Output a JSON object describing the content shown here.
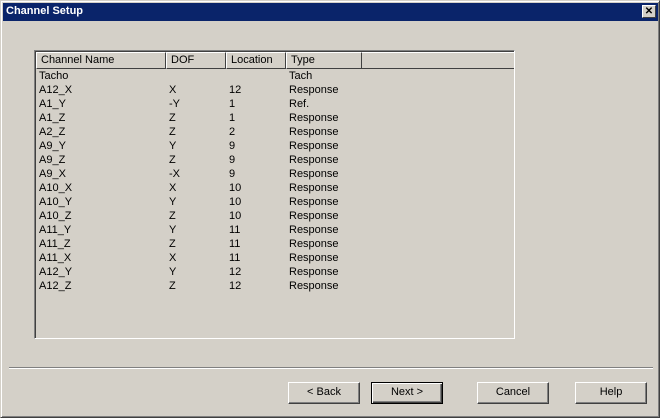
{
  "window": {
    "title": "Channel Setup",
    "close_glyph": "✕"
  },
  "table": {
    "headers": [
      "Channel Name",
      "DOF",
      "Location",
      "Type"
    ],
    "rows": [
      [
        "Tacho",
        "",
        "",
        "Tach"
      ],
      [
        "A12_X",
        "X",
        "12",
        "Response"
      ],
      [
        "A1_Y",
        "-Y",
        "1",
        "Ref."
      ],
      [
        "A1_Z",
        "Z",
        "1",
        "Response"
      ],
      [
        "A2_Z",
        "Z",
        "2",
        "Response"
      ],
      [
        "A9_Y",
        "Y",
        "9",
        "Response"
      ],
      [
        "A9_Z",
        "Z",
        "9",
        "Response"
      ],
      [
        "A9_X",
        "-X",
        "9",
        "Response"
      ],
      [
        "A10_X",
        "X",
        "10",
        "Response"
      ],
      [
        "A10_Y",
        "Y",
        "10",
        "Response"
      ],
      [
        "A10_Z",
        "Z",
        "10",
        "Response"
      ],
      [
        "A11_Y",
        "Y",
        "11",
        "Response"
      ],
      [
        "A11_Z",
        "Z",
        "11",
        "Response"
      ],
      [
        "A11_X",
        "X",
        "11",
        "Response"
      ],
      [
        "A12_Y",
        "Y",
        "12",
        "Response"
      ],
      [
        "A12_Z",
        "Z",
        "12",
        "Response"
      ]
    ]
  },
  "buttons": {
    "back": "< Back",
    "next": "Next >",
    "cancel": "Cancel",
    "help": "Help"
  }
}
